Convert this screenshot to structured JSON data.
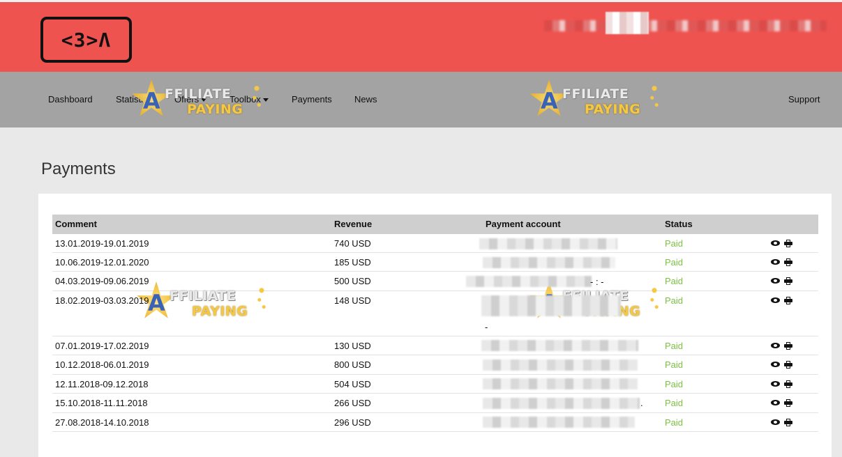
{
  "header": {
    "logo_text": "<3>Λ",
    "colors": {
      "header_bg": "#ef5350",
      "nav_bg": "#a3a3a3",
      "status_paid": "#7cc144"
    }
  },
  "nav": {
    "items": [
      {
        "label": "Dashboard"
      },
      {
        "label": "Statistics"
      },
      {
        "label": "Offers"
      },
      {
        "label": "Toolbox"
      },
      {
        "label": "Payments"
      },
      {
        "label": "News"
      }
    ],
    "support_label": "Support"
  },
  "watermark": {
    "line1": "FFILIATE",
    "line2": "PAYING",
    "letter": "A"
  },
  "page": {
    "title": "Payments"
  },
  "table": {
    "headers": {
      "comment": "Comment",
      "revenue": "Revenue",
      "account": "Payment account",
      "status": "Status"
    },
    "rows": [
      {
        "comment": "13.01.2019-19.01.2019",
        "revenue": "740 USD",
        "status": "Paid",
        "account_extra": ""
      },
      {
        "comment": "10.06.2019-12.01.2020",
        "revenue": "185 USD",
        "status": "Paid",
        "account_extra": ""
      },
      {
        "comment": "04.03.2019-09.06.2019",
        "revenue": "500 USD",
        "status": "Paid",
        "account_extra": "- : -"
      },
      {
        "comment": "18.02.2019-03.03.2019",
        "revenue": "148 USD",
        "status": "Paid",
        "account_extra": "-"
      },
      {
        "comment": "07.01.2019-17.02.2019",
        "revenue": "130 USD",
        "status": "Paid",
        "account_extra": ""
      },
      {
        "comment": "10.12.2018-06.01.2019",
        "revenue": "800 USD",
        "status": "Paid",
        "account_extra": ""
      },
      {
        "comment": "12.11.2018-09.12.2018",
        "revenue": "504 USD",
        "status": "Paid",
        "account_extra": ""
      },
      {
        "comment": "15.10.2018-11.11.2018",
        "revenue": "266 USD",
        "status": "Paid",
        "account_extra": "."
      },
      {
        "comment": "27.08.2018-14.10.2018",
        "revenue": "296 USD",
        "status": "Paid",
        "account_extra": ""
      }
    ]
  }
}
